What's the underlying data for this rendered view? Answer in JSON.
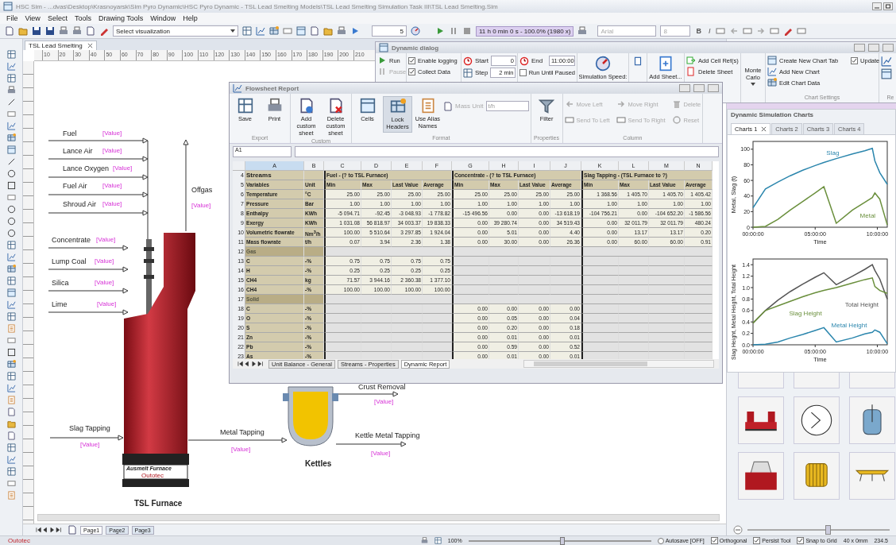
{
  "window": {
    "title": "HSC Sim - ...dvas\\Desktop\\Krasnoyarsk\\Sim Pyro Dynamic\\HSC Pyro Dynamic - TSL Lead Smelting Models\\TSL Lead Smelting Simulation Task III\\TSL Lead Smelting.Sim"
  },
  "menu": [
    "File",
    "View",
    "Select",
    "Tools",
    "Drawing Tools",
    "Window",
    "Help"
  ],
  "toolbar": {
    "visualization": "Select visualization",
    "spin_value": "5",
    "sim_time": "11 h 0 min 0 s - 100.0% (1980 x)",
    "font": "Arial",
    "font_size": "8",
    "format_buttons": [
      "B",
      "I"
    ]
  },
  "document_tab": "TSL Lead Smelting",
  "ruler": [
    "10",
    "20",
    "30",
    "40",
    "50",
    "60",
    "70",
    "80",
    "90",
    "100",
    "110",
    "120",
    "130",
    "140",
    "150",
    "160",
    "170",
    "180",
    "190",
    "200",
    "210"
  ],
  "flowsheet": {
    "streams": [
      {
        "label": "Fuel",
        "value": "[Value]"
      },
      {
        "label": "Lance Air",
        "value": "[Value]"
      },
      {
        "label": "Lance Oxygen",
        "value": "[Value]"
      },
      {
        "label": "Fuel Air",
        "value": "[Value]"
      },
      {
        "label": "Shroud Air",
        "value": "[Value]"
      },
      {
        "label": "Concentrate",
        "value": "[Value]"
      },
      {
        "label": "Lump Coal",
        "value": "[Value]"
      },
      {
        "label": "Silica",
        "value": "[Value]"
      },
      {
        "label": "Lime",
        "value": "[Value]"
      },
      {
        "label": "Offgas",
        "value": "[Value]"
      },
      {
        "label": "Slag Tapping",
        "value": "[Value]"
      },
      {
        "label": "Metal Tapping",
        "value": "[Value]"
      },
      {
        "label": "Crust Removal",
        "value": "[Value]"
      },
      {
        "label": "Kettle Metal Tapping",
        "value": "[Value]"
      }
    ],
    "units": [
      {
        "kind": "furnace",
        "name": "TSL Furnace",
        "plate_title": "Ausmelt Furnace",
        "plate_brand": "Outotec"
      },
      {
        "kind": "kettle",
        "name": "Kettles"
      }
    ]
  },
  "page_tabs": [
    {
      "label": "Page1",
      "selected": true
    },
    {
      "label": "Page2",
      "selected": false
    },
    {
      "label": "Page3",
      "selected": false
    }
  ],
  "dynamic_dialog": {
    "title": "Dynamic dialog",
    "groups": [
      {
        "items": [
          {
            "kind": "button",
            "label": "Run",
            "disabled": false
          },
          {
            "kind": "button",
            "label": "Pause",
            "disabled": true
          }
        ]
      },
      {
        "items": [
          {
            "kind": "check",
            "label": "Enable logging",
            "checked": true
          },
          {
            "kind": "check",
            "label": "Collect Data",
            "checked": true
          }
        ]
      },
      {
        "items": [
          {
            "kind": "field",
            "label": "Start",
            "value": "0"
          },
          {
            "kind": "field",
            "label": "Step",
            "value": "2 min"
          }
        ]
      },
      {
        "items": [
          {
            "kind": "field",
            "label": "End",
            "value": "11:00:00"
          },
          {
            "kind": "check",
            "label": "Run Until Paused",
            "checked": false
          }
        ]
      },
      {
        "items": [
          {
            "kind": "large",
            "label": "Simulation Speed:"
          }
        ]
      },
      {
        "items": [
          {
            "kind": "icon"
          }
        ]
      },
      {
        "items": [
          {
            "kind": "large",
            "label": "Add Sheet..."
          }
        ]
      },
      {
        "items": [
          {
            "kind": "button",
            "label": "Add Cell Ref(s)",
            "disabled": false
          },
          {
            "kind": "button",
            "label": "Delete Sheet",
            "disabled": false
          }
        ]
      },
      {
        "items": [
          {
            "kind": "menu",
            "label": "Monte Carlo"
          }
        ]
      },
      {
        "label": "Chart Settings",
        "items": [
          {
            "kind": "button",
            "label": "Create New Chart Tab",
            "disabled": false
          },
          {
            "kind": "button",
            "label": "Add New Chart",
            "disabled": false
          },
          {
            "kind": "button",
            "label": "Edit Chart Data",
            "disabled": false
          },
          {
            "kind": "check",
            "label": "Update",
            "checked": true
          }
        ]
      },
      {
        "label": "Re",
        "items": [
          {
            "kind": "icon"
          },
          {
            "kind": "icon"
          }
        ]
      }
    ]
  },
  "flowsheet_report": {
    "title": "Flowsheet Report",
    "groups": [
      {
        "label": "Export",
        "items": [
          {
            "kind": "large",
            "label": "Save",
            "disabled": false,
            "on": false
          },
          {
            "kind": "large",
            "label": "Print",
            "disabled": false,
            "on": false
          }
        ]
      },
      {
        "label": "Custom",
        "items": [
          {
            "kind": "large",
            "label": "Add custom sheet",
            "disabled": false,
            "on": false
          },
          {
            "kind": "large",
            "label": "Delete custom sheet",
            "disabled": false,
            "on": false
          }
        ]
      },
      {
        "label": "Format",
        "items": [
          {
            "kind": "large",
            "label": "Cells",
            "disabled": false,
            "on": false
          },
          {
            "kind": "large",
            "label": "Lock Headers",
            "disabled": false,
            "on": true
          },
          {
            "kind": "large",
            "label": "Use Alias Names",
            "disabled": false,
            "on": false
          },
          {
            "kind": "field",
            "label": "Mass Unit",
            "value": "t/h",
            "disabled": true,
            "on": false
          }
        ]
      },
      {
        "label": "Properties",
        "items": [
          {
            "kind": "large",
            "label": "Filter",
            "disabled": false,
            "on": false
          }
        ]
      },
      {
        "label": "Column",
        "items": [
          {
            "kind": "small",
            "label": "Move Left",
            "disabled": true,
            "on": false
          },
          {
            "kind": "small",
            "label": "Send To Left",
            "disabled": true,
            "on": false
          },
          {
            "kind": "small",
            "label": "Move Right",
            "disabled": true,
            "on": false
          },
          {
            "kind": "small",
            "label": "Send To Right",
            "disabled": true,
            "on": false
          },
          {
            "kind": "small",
            "label": "Delete",
            "disabled": true,
            "on": false
          },
          {
            "kind": "small",
            "label": "Reset",
            "disabled": true,
            "on": false
          }
        ]
      }
    ],
    "cell_ref": "A1",
    "columns": [
      {
        "label": "A",
        "selected": true
      },
      {
        "label": "B",
        "selected": false
      },
      {
        "label": "C",
        "selected": false
      },
      {
        "label": "D",
        "selected": false
      },
      {
        "label": "E",
        "selected": false
      },
      {
        "label": "F",
        "selected": false
      },
      {
        "label": "G",
        "selected": false
      },
      {
        "label": "H",
        "selected": false
      },
      {
        "label": "I",
        "selected": false
      },
      {
        "label": "J",
        "selected": false
      },
      {
        "label": "K",
        "selected": false
      },
      {
        "label": "L",
        "selected": false
      },
      {
        "label": "M",
        "selected": false
      },
      {
        "label": "N",
        "selected": false
      }
    ],
    "rows": [
      {
        "num": "4",
        "kind": "groups",
        "label": "Streams",
        "groups": [
          "Fuel - (? to TSL Furnace)",
          "Concentrate - (? to TSL Furnace)",
          "Slag Tapping - (TSL Furnace to ?)"
        ]
      },
      {
        "num": "5",
        "kind": "subheader",
        "cells": [
          "Variables",
          "Unit",
          "Min",
          "Max",
          "Last Value",
          "Average",
          "Min",
          "Max",
          "Last Value",
          "Average",
          "Min",
          "Max",
          "Last Value",
          "Average"
        ]
      },
      {
        "num": "6",
        "kind": "data",
        "cells": [
          "Temperature",
          "°C",
          "25.00",
          "25.00",
          "25.00",
          "25.00",
          "25.00",
          "25.00",
          "25.00",
          "25.00",
          "1 368.56",
          "1 405.70",
          "1 405.70",
          "1 405.42"
        ]
      },
      {
        "num": "7",
        "kind": "data",
        "cells": [
          "Pressure",
          "Bar",
          "1.00",
          "1.00",
          "1.00",
          "1.00",
          "1.00",
          "1.00",
          "1.00",
          "1.00",
          "1.00",
          "1.00",
          "1.00",
          "1.00"
        ]
      },
      {
        "num": "8",
        "kind": "data",
        "cells": [
          "Enthalpy",
          "KWh",
          "-5 094.71",
          "-92.45",
          "-3 048.93",
          "-1 778.82",
          "-15 496.56",
          "0.00",
          "0.00",
          "-13 618.19",
          "-104 756.21",
          "0.00",
          "-104 652.20",
          "-1 586.56"
        ]
      },
      {
        "num": "9",
        "kind": "data",
        "cells": [
          "Exergy",
          "KWh",
          "1 031.08",
          "56 818.97",
          "34 003.37",
          "19 838.33",
          "0.00",
          "39 280.74",
          "0.00",
          "34 519.43",
          "0.00",
          "32 011.79",
          "32 011.79",
          "480.24"
        ]
      },
      {
        "num": "10",
        "kind": "data",
        "cells": [
          "Volumetric flowrate",
          "Nm$^{3}$/h",
          "100.00",
          "5 510.64",
          "3 297.85",
          "1 924.04",
          "0.00",
          "5.01",
          "0.00",
          "4.40",
          "0.00",
          "13.17",
          "13.17",
          "0.20"
        ]
      },
      {
        "num": "11",
        "kind": "data",
        "cells": [
          "Mass flowrate",
          "t/h",
          "0.07",
          "3.94",
          "2.36",
          "1.38",
          "0.00",
          "30.00",
          "0.00",
          "26.36",
          "0.00",
          "60.00",
          "60.00",
          "0.91"
        ]
      },
      {
        "num": "12",
        "kind": "section",
        "label": "Gas"
      },
      {
        "num": "13",
        "kind": "data",
        "cells": [
          "C",
          "-%",
          "0.75",
          "0.75",
          "0.75",
          "0.75",
          null,
          null,
          null,
          null,
          null,
          null,
          null,
          null
        ]
      },
      {
        "num": "14",
        "kind": "data",
        "cells": [
          "H",
          "-%",
          "0.25",
          "0.25",
          "0.25",
          "0.25",
          null,
          null,
          null,
          null,
          null,
          null,
          null,
          null
        ]
      },
      {
        "num": "15",
        "kind": "data",
        "cells": [
          "CH4",
          "kg",
          "71.57",
          "3 944.16",
          "2 360.38",
          "1 377.10",
          null,
          null,
          null,
          null,
          null,
          null,
          null,
          null
        ]
      },
      {
        "num": "16",
        "kind": "data",
        "cells": [
          "CH4",
          "-%",
          "100.00",
          "100.00",
          "100.00",
          "100.00",
          null,
          null,
          null,
          null,
          null,
          null,
          null,
          null
        ]
      },
      {
        "num": "17",
        "kind": "section",
        "label": "Solid"
      },
      {
        "num": "18",
        "kind": "data",
        "cells": [
          "C",
          "-%",
          null,
          null,
          null,
          null,
          "0.00",
          "0.00",
          "0.00",
          "0.00",
          null,
          null,
          null,
          null
        ]
      },
      {
        "num": "19",
        "kind": "data",
        "cells": [
          "O",
          "-%",
          null,
          null,
          null,
          null,
          "0.00",
          "0.05",
          "0.00",
          "0.04",
          null,
          null,
          null,
          null
        ]
      },
      {
        "num": "20",
        "kind": "data",
        "cells": [
          "S",
          "-%",
          null,
          null,
          null,
          null,
          "0.00",
          "0.20",
          "0.00",
          "0.18",
          null,
          null,
          null,
          null
        ]
      },
      {
        "num": "21",
        "kind": "data",
        "cells": [
          "Zn",
          "-%",
          null,
          null,
          null,
          null,
          "0.00",
          "0.01",
          "0.00",
          "0.01",
          null,
          null,
          null,
          null
        ]
      },
      {
        "num": "22",
        "kind": "data",
        "cells": [
          "Pb",
          "-%",
          null,
          null,
          null,
          null,
          "0.00",
          "0.59",
          "0.00",
          "0.52",
          null,
          null,
          null,
          null
        ]
      },
      {
        "num": "23",
        "kind": "data",
        "cells": [
          "As",
          "-%",
          null,
          null,
          null,
          null,
          "0.00",
          "0.01",
          "0.00",
          "0.01",
          null,
          null,
          null,
          null
        ]
      }
    ],
    "sheet_tabs": [
      {
        "label": "Unit Balance - General",
        "selected": false
      },
      {
        "label": "Streams - Properties",
        "selected": false
      },
      {
        "label": "Dynamic Report",
        "selected": true
      }
    ]
  },
  "charts_panel": {
    "title": "Dynamic Simulation Charts",
    "tabs": [
      {
        "label": "Charts 1",
        "selected": true
      },
      {
        "label": "Charts 2",
        "selected": false
      },
      {
        "label": "Charts 3",
        "selected": false
      },
      {
        "label": "Charts 4",
        "selected": false
      }
    ],
    "charts": [
      {
        "chart_data": {
          "type": "line",
          "xlabel": "Time",
          "ylabel": "Metal, Slag (t)",
          "x": [
            0,
            1,
            2,
            3,
            4,
            5,
            5.7,
            6.7,
            8,
            9,
            9.6,
            9.8,
            10.2,
            10.8
          ],
          "xlim": [
            0,
            10.8
          ],
          "ylim": [
            0,
            110
          ],
          "xticks": [
            {
              "value": 0,
              "label": "00:00:00"
            },
            {
              "value": 5,
              "label": "05:00:00"
            },
            {
              "value": 10,
              "label": "10:00:00"
            }
          ],
          "yticks": [
            0,
            20,
            40,
            60,
            80,
            100
          ],
          "series": [
            {
              "name": "Slag",
              "color": "#2b86ad",
              "values": [
                25,
                49,
                58,
                66,
                73,
                79,
                83,
                88,
                94,
                98,
                101,
                85,
                70,
                55
              ]
            },
            {
              "name": "Metal",
              "color": "#6a8f3c",
              "values": [
                0,
                1,
                10,
                22,
                33,
                44,
                52,
                5,
                22,
                32,
                38,
                44,
                36,
                3
              ]
            }
          ]
        }
      },
      {
        "chart_data": {
          "type": "line",
          "xlabel": "Time",
          "ylabel": "Slag Height, Metal Height, Total Height",
          "x": [
            0,
            1,
            2,
            3,
            4,
            5,
            5.7,
            6.7,
            8,
            9,
            9.6,
            9.8,
            10.2,
            10.8
          ],
          "xlim": [
            0,
            10.8
          ],
          "ylim": [
            0,
            1.5
          ],
          "xticks": [
            {
              "value": 0,
              "label": "00:00:00"
            },
            {
              "value": 5,
              "label": "05:00:00"
            },
            {
              "value": 10,
              "label": "10:00:00"
            }
          ],
          "yticks": [
            {
              "value": 0,
              "label": "0.0"
            },
            {
              "value": 0.2,
              "label": "0.2"
            },
            {
              "value": 0.4,
              "label": "0.4"
            },
            {
              "value": 0.6,
              "label": "0.6"
            },
            {
              "value": 0.8,
              "label": "0.8"
            },
            {
              "value": 1,
              "label": "1.0"
            },
            {
              "value": 1.2,
              "label": "1.2"
            },
            {
              "value": 1.4,
              "label": "1.4"
            }
          ],
          "series": [
            {
              "name": "Total Height",
              "color": "#555555",
              "values": [
                0.38,
                0.6,
                0.78,
                0.93,
                1.06,
                1.18,
                1.26,
                1.05,
                1.2,
                1.32,
                1.4,
                1.3,
                1.15,
                0.8
              ]
            },
            {
              "name": "Slag Height",
              "color": "#6a8f3c",
              "values": [
                0.38,
                0.6,
                0.68,
                0.76,
                0.84,
                0.91,
                0.95,
                1.0,
                1.08,
                1.14,
                1.17,
                1.02,
                0.95,
                0.9
              ]
            },
            {
              "name": "Metal Height",
              "color": "#2b86ad",
              "values": [
                0,
                0.01,
                0.05,
                0.12,
                0.18,
                0.25,
                0.3,
                0.05,
                0.12,
                0.19,
                0.22,
                0.26,
                0.22,
                0.02
              ]
            }
          ]
        }
      }
    ]
  },
  "palette": {
    "zoom": {
      "level": 0.55
    }
  },
  "status_bar": {
    "brand": "Outotec",
    "zoom": "100%",
    "zoom_slider": {
      "level": 0.5
    },
    "autosave": {
      "label": "Autosave [OFF]",
      "selected": false
    },
    "options": [
      {
        "label": "Orthogonal",
        "checked": true
      },
      {
        "label": "Persist Tool",
        "checked": true
      },
      {
        "label": "Snap to Grid",
        "checked": true
      }
    ],
    "size": "40 x 0mm",
    "coordinate": "234.5"
  }
}
